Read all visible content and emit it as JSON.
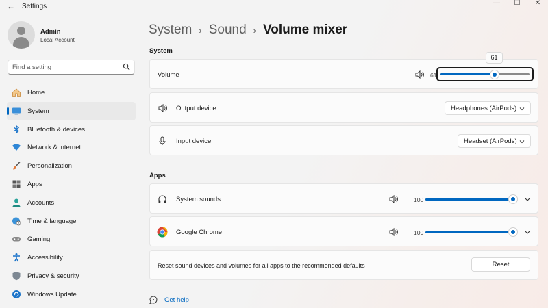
{
  "window": {
    "title": "Settings",
    "back_glyph": "←",
    "min_glyph": "—",
    "max_glyph": "☐",
    "close_glyph": "✕"
  },
  "profile": {
    "name": "Admin",
    "subtitle": "Local Account"
  },
  "search": {
    "placeholder": "Find a setting",
    "icon": "search-icon"
  },
  "sidebar": {
    "items": [
      {
        "label": "Home",
        "icon": "home-icon"
      },
      {
        "label": "System",
        "icon": "monitor-icon",
        "active": true
      },
      {
        "label": "Bluetooth & devices",
        "icon": "bluetooth-icon"
      },
      {
        "label": "Network & internet",
        "icon": "wifi-icon"
      },
      {
        "label": "Personalization",
        "icon": "brush-icon"
      },
      {
        "label": "Apps",
        "icon": "apps-icon"
      },
      {
        "label": "Accounts",
        "icon": "person-icon"
      },
      {
        "label": "Time & language",
        "icon": "globe-clock-icon"
      },
      {
        "label": "Gaming",
        "icon": "gamepad-icon"
      },
      {
        "label": "Accessibility",
        "icon": "accessibility-icon"
      },
      {
        "label": "Privacy & security",
        "icon": "shield-icon"
      },
      {
        "label": "Windows Update",
        "icon": "update-icon"
      }
    ]
  },
  "breadcrumb": {
    "part1": "System",
    "part2": "Sound",
    "current": "Volume mixer",
    "separator": "›"
  },
  "system_section": {
    "title": "System",
    "volume": {
      "label": "Volume",
      "value": 61,
      "value_text": "61",
      "tooltip": "61"
    },
    "output": {
      "label": "Output device",
      "selected": "Headphones (AirPods)"
    },
    "input": {
      "label": "Input device",
      "selected": "Headset (AirPods)"
    }
  },
  "apps_section": {
    "title": "Apps",
    "apps": [
      {
        "label": "System sounds",
        "value": 100,
        "value_text": "100",
        "icon": "headphones-icon"
      },
      {
        "label": "Google Chrome",
        "value": 100,
        "value_text": "100",
        "icon": "chrome-icon"
      }
    ],
    "reset": {
      "label": "Reset sound devices and volumes for all apps to the recommended defaults",
      "button": "Reset"
    }
  },
  "help": {
    "label": "Get help"
  },
  "colors": {
    "accent": "#0067c0",
    "background": "#f3f3f3",
    "card": "#fbfbfb"
  }
}
